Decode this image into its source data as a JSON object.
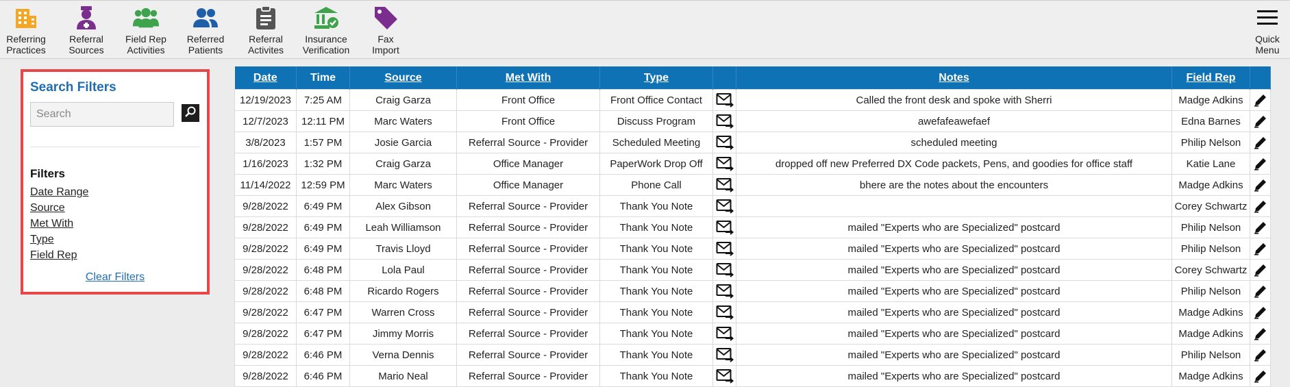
{
  "toolbar": {
    "items": [
      {
        "label": "Referring\nPractices",
        "icon": "building-icon",
        "color": "#f5a623"
      },
      {
        "label": "Referral\nSources",
        "icon": "doctor-icon",
        "color": "#7b2e8e"
      },
      {
        "label": "Field Rep\nActivities",
        "icon": "group-icon",
        "color": "#3fa34d"
      },
      {
        "label": "Referred\nPatients",
        "icon": "users-icon",
        "color": "#1f5fa8"
      },
      {
        "label": "Referral\nActivites",
        "icon": "clipboard-icon",
        "color": "#555555"
      },
      {
        "label": "Insurance\nVerification",
        "icon": "bank-check-icon",
        "color": "#3fa34d"
      },
      {
        "label": "Fax\nImport",
        "icon": "tag-icon",
        "color": "#7b2e8e"
      }
    ],
    "quick_menu_label": "Quick\nMenu"
  },
  "filters": {
    "title": "Search Filters",
    "search_placeholder": "Search",
    "filters_heading": "Filters",
    "links": [
      "Date Range",
      "Source",
      "Met With",
      "Type",
      "Field Rep"
    ],
    "clear_label": "Clear Filters"
  },
  "table": {
    "headers": {
      "date": "Date",
      "time": "Time",
      "source": "Source",
      "met_with": "Met With",
      "type": "Type",
      "notes": "Notes",
      "field_rep": "Field Rep"
    },
    "rows": [
      {
        "date": "12/19/2023",
        "time": "7:25 AM",
        "source": "Craig Garza",
        "met_with": "Front Office",
        "type": "Front Office Contact",
        "notes": "Called the front desk and spoke with Sherri",
        "field_rep": "Madge Adkins"
      },
      {
        "date": "12/7/2023",
        "time": "12:11 PM",
        "source": "Marc Waters",
        "met_with": "Front Office",
        "type": "Discuss Program",
        "notes": "awefafeawefaef",
        "field_rep": "Edna Barnes"
      },
      {
        "date": "3/8/2023",
        "time": "1:57 PM",
        "source": "Josie Garcia",
        "met_with": "Referral Source - Provider",
        "type": "Scheduled Meeting",
        "notes": "scheduled meeting",
        "field_rep": "Philip Nelson"
      },
      {
        "date": "1/16/2023",
        "time": "1:32 PM",
        "source": "Craig Garza",
        "met_with": "Office Manager",
        "type": "PaperWork Drop Off",
        "notes": "dropped off new Preferred DX Code packets, Pens, and goodies for office staff",
        "field_rep": "Katie Lane"
      },
      {
        "date": "11/14/2022",
        "time": "12:59 PM",
        "source": "Marc Waters",
        "met_with": "Office Manager",
        "type": "Phone Call",
        "notes": "bhere are the notes about the encounters",
        "field_rep": "Madge Adkins"
      },
      {
        "date": "9/28/2022",
        "time": "6:49 PM",
        "source": "Alex Gibson",
        "met_with": "Referral Source - Provider",
        "type": "Thank You Note",
        "notes": "",
        "field_rep": "Corey Schwartz"
      },
      {
        "date": "9/28/2022",
        "time": "6:49 PM",
        "source": "Leah Williamson",
        "met_with": "Referral Source - Provider",
        "type": "Thank You Note",
        "notes": "mailed \"Experts who are Specialized\" postcard",
        "field_rep": "Philip Nelson"
      },
      {
        "date": "9/28/2022",
        "time": "6:49 PM",
        "source": "Travis Lloyd",
        "met_with": "Referral Source - Provider",
        "type": "Thank You Note",
        "notes": "mailed \"Experts who are Specialized\" postcard",
        "field_rep": "Philip Nelson"
      },
      {
        "date": "9/28/2022",
        "time": "6:48 PM",
        "source": "Lola Paul",
        "met_with": "Referral Source - Provider",
        "type": "Thank You Note",
        "notes": "mailed \"Experts who are Specialized\" postcard",
        "field_rep": "Corey Schwartz"
      },
      {
        "date": "9/28/2022",
        "time": "6:48 PM",
        "source": "Ricardo Rogers",
        "met_with": "Referral Source - Provider",
        "type": "Thank You Note",
        "notes": "mailed \"Experts who are Specialized\" postcard",
        "field_rep": "Philip Nelson"
      },
      {
        "date": "9/28/2022",
        "time": "6:47 PM",
        "source": "Warren Cross",
        "met_with": "Referral Source - Provider",
        "type": "Thank You Note",
        "notes": "mailed \"Experts who are Specialized\" postcard",
        "field_rep": "Madge Adkins"
      },
      {
        "date": "9/28/2022",
        "time": "6:47 PM",
        "source": "Jimmy Morris",
        "met_with": "Referral Source - Provider",
        "type": "Thank You Note",
        "notes": "mailed \"Experts who are Specialized\" postcard",
        "field_rep": "Madge Adkins"
      },
      {
        "date": "9/28/2022",
        "time": "6:46 PM",
        "source": "Verna Dennis",
        "met_with": "Referral Source - Provider",
        "type": "Thank You Note",
        "notes": "mailed \"Experts who are Specialized\" postcard",
        "field_rep": "Philip Nelson"
      },
      {
        "date": "9/28/2022",
        "time": "6:46 PM",
        "source": "Mario Neal",
        "met_with": "Referral Source - Provider",
        "type": "Thank You Note",
        "notes": "mailed \"Experts who are Specialized\" postcard",
        "field_rep": "Madge Adkins"
      }
    ]
  },
  "colors": {
    "header_blue": "#0e72b5",
    "highlight_red": "#e8474a",
    "title_blue": "#1f6db3"
  }
}
